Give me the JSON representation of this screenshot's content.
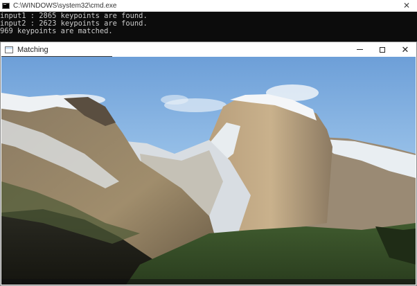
{
  "console_window": {
    "title": "C:\\WINDOWS\\system32\\cmd.exe",
    "icon": "console-icon",
    "lines": [
      "input1 : 2865 keypoints are found.",
      "input2 : 2623 keypoints are found.",
      "969 keypoints are matched."
    ],
    "text_color": "#cccccc",
    "background": "#0c0c0c"
  },
  "matching_window": {
    "title": "Matching",
    "icon": "app-window-icon",
    "controls": {
      "minimize": "minimize-icon",
      "maximize": "maximize-icon",
      "close": "close-icon"
    },
    "image": "Yosemite valley with Half Dome, snowy granite cliffs under a blue sky"
  }
}
